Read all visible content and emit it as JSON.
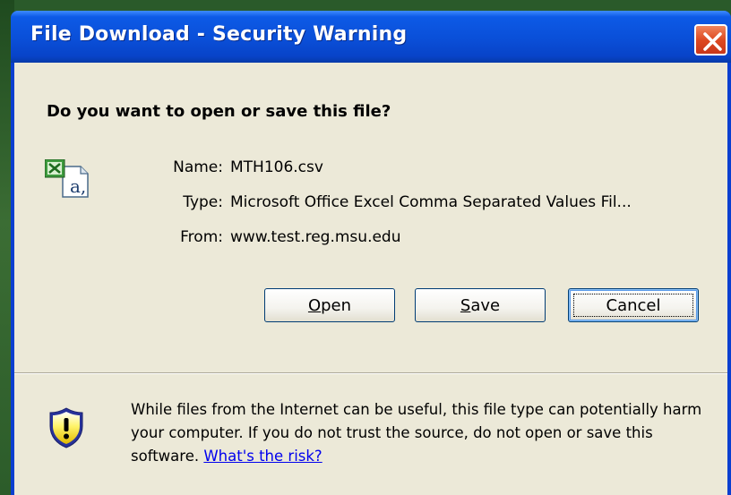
{
  "dialog": {
    "title": "File Download - Security Warning",
    "question": "Do you want to open or save this file?"
  },
  "file": {
    "icon": "excel-csv-file-icon",
    "name_label": "Name:",
    "name": "MTH106.csv",
    "type_label": "Type:",
    "type": "Microsoft Office Excel Comma Separated Values Fil...",
    "from_label": "From:",
    "from": "www.test.reg.msu.edu"
  },
  "buttons": {
    "open_accel": "O",
    "open_rest": "pen",
    "save_accel": "S",
    "save_rest": "ave",
    "cancel": "Cancel"
  },
  "warning": {
    "icon": "security-shield-warning-icon",
    "text": "While files from the Internet can be useful, this file type can potentially harm your computer. If you do not trust the source, do not open or save this software.",
    "link": "What's the risk?"
  },
  "colors": {
    "titlebar": "#0a4fd8",
    "client": "#ece9d8",
    "close_button": "#de4a22",
    "link": "#0000ee",
    "desktop": "#2a5a2a"
  }
}
